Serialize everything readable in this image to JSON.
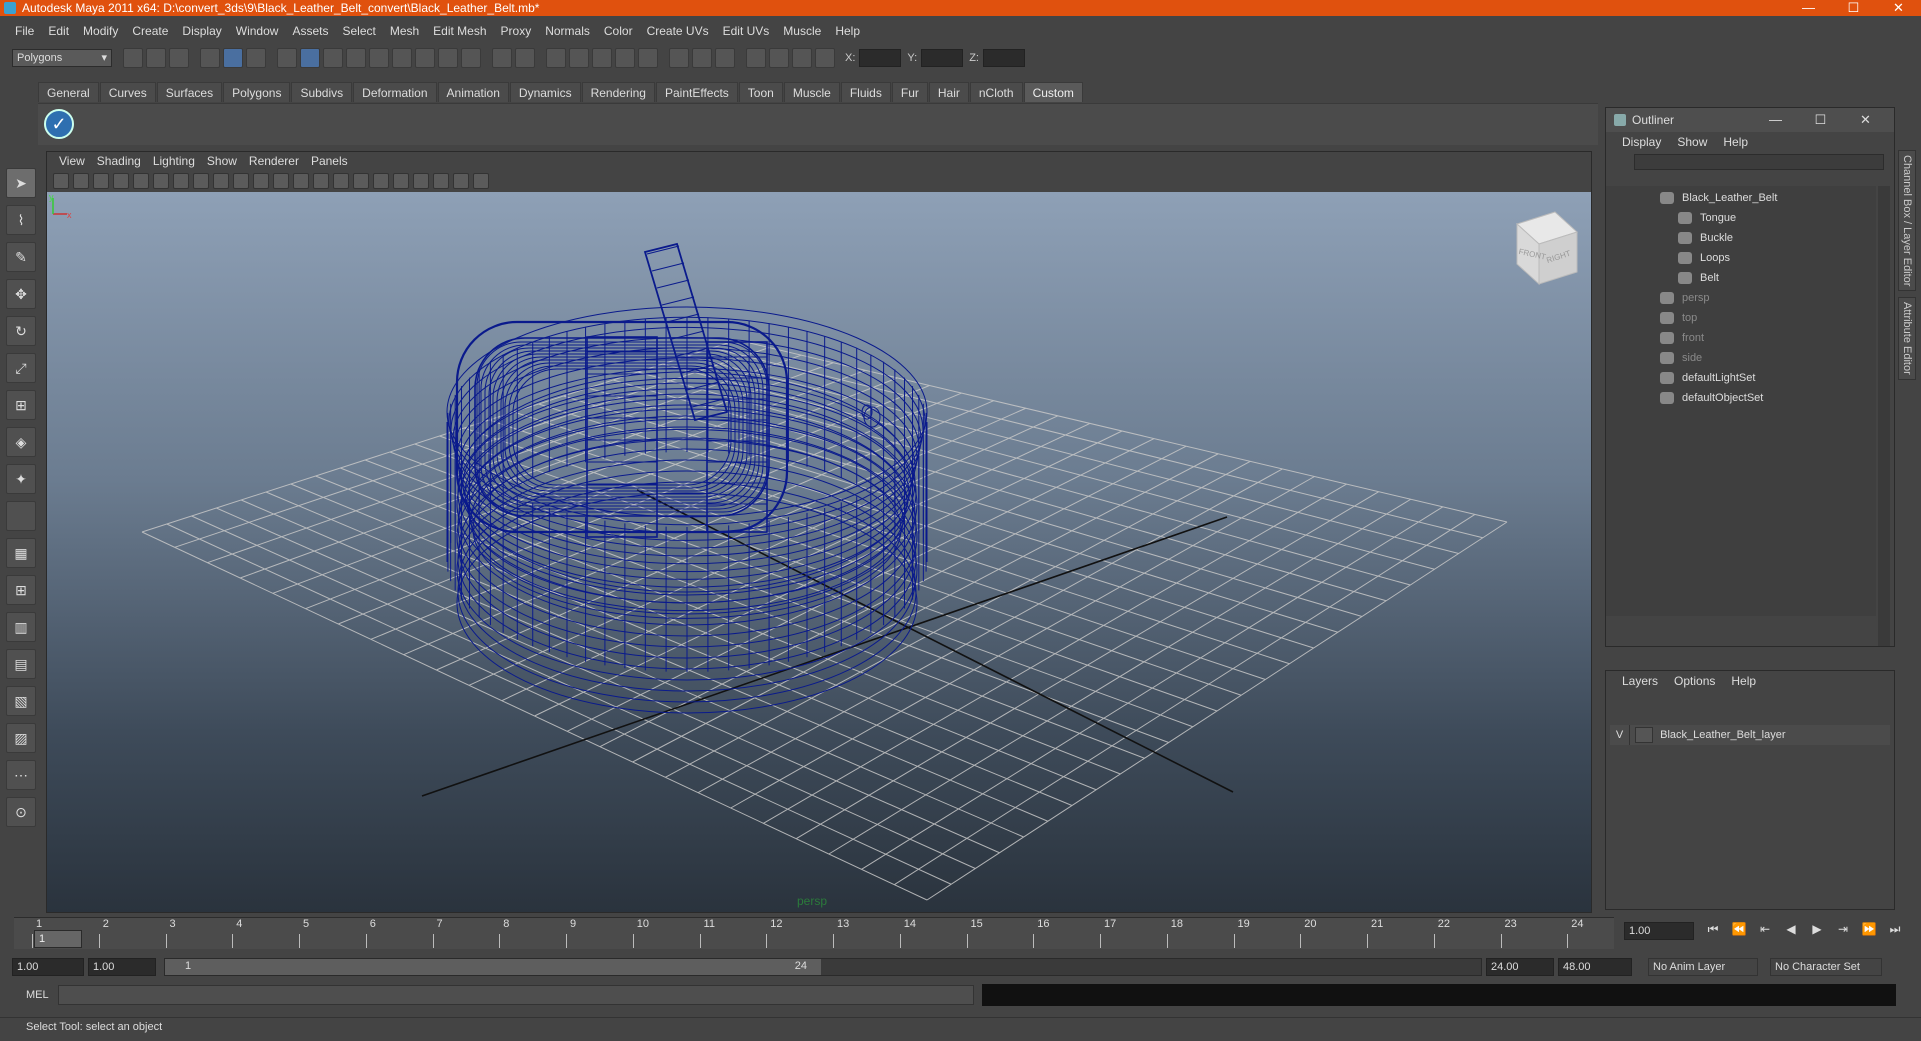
{
  "title": "Autodesk Maya 2011 x64: D:\\convert_3ds\\9\\Black_Leather_Belt_convert\\Black_Leather_Belt.mb*",
  "window_controls": [
    "—",
    "☐",
    "✕"
  ],
  "menu": [
    "File",
    "Edit",
    "Modify",
    "Create",
    "Display",
    "Window",
    "Assets",
    "Select",
    "Mesh",
    "Edit Mesh",
    "Proxy",
    "Normals",
    "Color",
    "Create UVs",
    "Edit UVs",
    "Muscle",
    "Help"
  ],
  "statusline": {
    "mode": "Polygons",
    "x_label": "X:",
    "y_label": "Y:",
    "z_label": "Z:"
  },
  "shelf_tabs": [
    "General",
    "Curves",
    "Surfaces",
    "Polygons",
    "Subdivs",
    "Deformation",
    "Animation",
    "Dynamics",
    "Rendering",
    "PaintEffects",
    "Toon",
    "Muscle",
    "Fluids",
    "Fur",
    "Hair",
    "nCloth",
    "Custom"
  ],
  "shelf_active": "Custom",
  "viewport": {
    "menu": [
      "View",
      "Shading",
      "Lighting",
      "Show",
      "Renderer",
      "Panels"
    ],
    "camera": "persp",
    "viewcube_front": "FRONT",
    "viewcube_right": "RIGHT",
    "axis_x": "x",
    "axis_y": "y"
  },
  "outliner": {
    "title": "Outliner",
    "menu": [
      "Display",
      "Show",
      "Help"
    ],
    "items": [
      {
        "label": "Black_Leather_Belt",
        "dim": false,
        "indent": 0
      },
      {
        "label": "Tongue",
        "dim": false,
        "indent": 1
      },
      {
        "label": "Buckle",
        "dim": false,
        "indent": 1
      },
      {
        "label": "Loops",
        "dim": false,
        "indent": 1
      },
      {
        "label": "Belt",
        "dim": false,
        "indent": 1
      },
      {
        "label": "persp",
        "dim": true,
        "indent": 0
      },
      {
        "label": "top",
        "dim": true,
        "indent": 0
      },
      {
        "label": "front",
        "dim": true,
        "indent": 0
      },
      {
        "label": "side",
        "dim": true,
        "indent": 0
      },
      {
        "label": "defaultLightSet",
        "dim": false,
        "indent": 0
      },
      {
        "label": "defaultObjectSet",
        "dim": false,
        "indent": 0
      }
    ]
  },
  "layers": {
    "menu": [
      "Layers",
      "Options",
      "Help"
    ],
    "row": {
      "visible": "V",
      "name": "Black_Leather_Belt_layer"
    }
  },
  "side_tabs": [
    "Channel Box / Layer Editor",
    "Attribute Editor"
  ],
  "timeline": {
    "ticks": [
      "1",
      "2",
      "3",
      "4",
      "5",
      "6",
      "7",
      "8",
      "9",
      "10",
      "11",
      "12",
      "13",
      "14",
      "15",
      "16",
      "17",
      "18",
      "19",
      "20",
      "21",
      "22",
      "23",
      "24"
    ],
    "playhead": "1",
    "current_frame": "1.00"
  },
  "range": {
    "start": "1.00",
    "playback_start": "1.00",
    "handle_start": "1",
    "handle_end": "24",
    "playback_end": "24.00",
    "end": "48.00",
    "anim_layer": "No Anim Layer",
    "character_set": "No Character Set"
  },
  "cmdline": {
    "label": "MEL"
  },
  "helpline": "Select Tool: select an object",
  "colors": {
    "title_bar": "#e0510e",
    "wireframe": "#0a1a8c",
    "grid": "#bfbfbf"
  }
}
